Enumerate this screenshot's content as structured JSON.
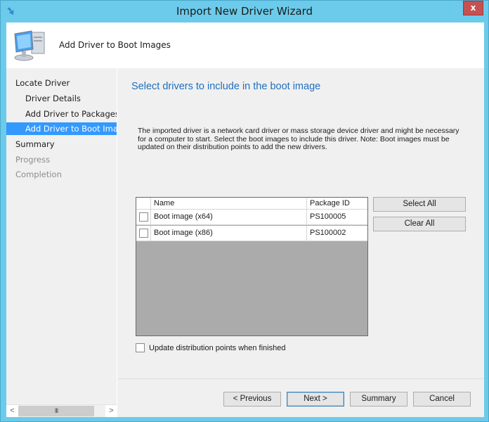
{
  "window": {
    "title": "Import New Driver Wizard",
    "close_label": "x",
    "app_icon": "wizard-arrow-icon"
  },
  "header": {
    "icon": "computer-icon",
    "title": "Add Driver to Boot Images"
  },
  "nav": {
    "items": [
      {
        "label": "Locate Driver",
        "level": 0,
        "state": "normal"
      },
      {
        "label": "Driver Details",
        "level": 1,
        "state": "normal"
      },
      {
        "label": "Add Driver to Packages",
        "level": 1,
        "state": "normal"
      },
      {
        "label": "Add Driver to Boot Images",
        "level": 1,
        "state": "active"
      },
      {
        "label": "Summary",
        "level": 0,
        "state": "normal"
      },
      {
        "label": "Progress",
        "level": 0,
        "state": "disabled"
      },
      {
        "label": "Completion",
        "level": 0,
        "state": "disabled"
      }
    ],
    "scroll_left": "<",
    "scroll_right": ">",
    "scroll_thumb": "III"
  },
  "main": {
    "title": "Select drivers to include in the boot image",
    "description": "The imported driver is a network card driver or mass storage device driver and might be necessary for a computer to start. Select the boot images to include this driver.  Note: Boot images must be updated on their distribution points to add the new drivers.",
    "grid": {
      "columns": [
        "",
        "Name",
        "Package ID"
      ],
      "rows": [
        {
          "checked": false,
          "name": "Boot image (x64)",
          "package_id": "PS100005"
        },
        {
          "checked": false,
          "name": "Boot image (x86)",
          "package_id": "PS100002"
        }
      ]
    },
    "select_all_label": "Select All",
    "clear_all_label": "Clear All",
    "update_dp": {
      "checked": false,
      "label": "Update distribution points when finished"
    }
  },
  "footer": {
    "previous_label": "< Previous",
    "next_label": "Next >",
    "summary_label": "Summary",
    "cancel_label": "Cancel"
  }
}
